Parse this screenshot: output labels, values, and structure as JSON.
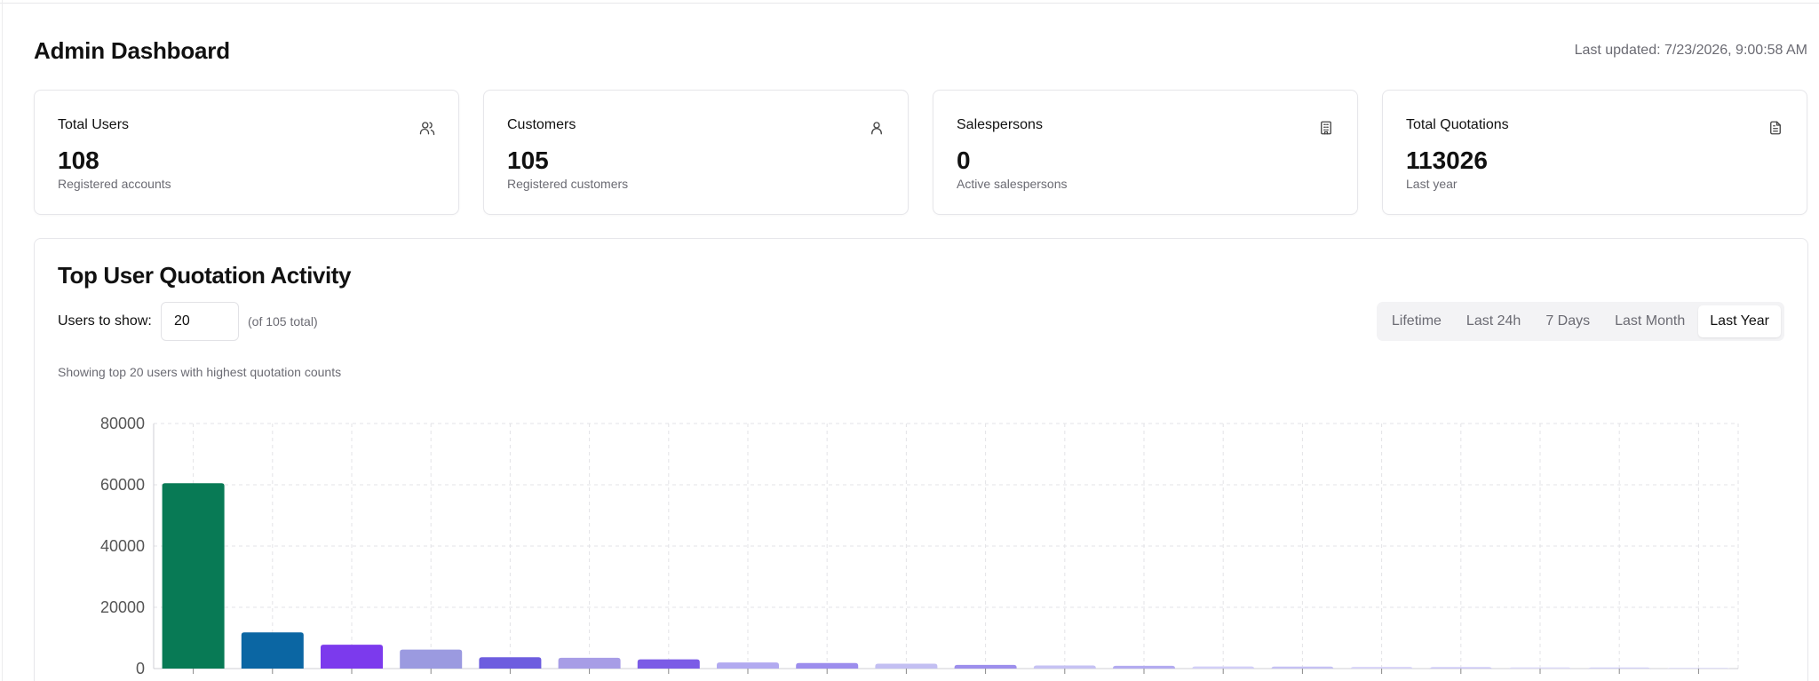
{
  "header": {
    "title": "Admin Dashboard",
    "last_updated": "Last updated: 7/23/2026, 9:00:58 AM"
  },
  "stats": [
    {
      "label": "Total Users",
      "value": "108",
      "sub": "Registered accounts",
      "icon": "users-icon"
    },
    {
      "label": "Customers",
      "value": "105",
      "sub": "Registered customers",
      "icon": "user-icon"
    },
    {
      "label": "Salespersons",
      "value": "0",
      "sub": "Active salespersons",
      "icon": "building-icon"
    },
    {
      "label": "Total Quotations",
      "value": "113026",
      "sub": "Last year",
      "icon": "file-text-icon"
    }
  ],
  "activity": {
    "title": "Top User Quotation Activity",
    "users_label": "Users to show:",
    "users_value": "20",
    "users_total": "(of 105 total)",
    "showing_note": "Showing top 20 users with highest quotation counts",
    "ranges": [
      "Lifetime",
      "Last 24h",
      "7 Days",
      "Last Month",
      "Last Year"
    ],
    "active_range": "Last Year"
  },
  "chart_data": {
    "type": "bar",
    "title": "",
    "xlabel": "",
    "ylabel": "",
    "ylim": [
      0,
      80000
    ],
    "yticks": [
      0,
      20000,
      40000,
      60000,
      80000
    ],
    "grid": true,
    "values": [
      60500,
      11800,
      7800,
      6200,
      3700,
      3500,
      3000,
      2000,
      1800,
      1600,
      1200,
      1000,
      900,
      700,
      650,
      550,
      480,
      400,
      350,
      300
    ],
    "colors": [
      "#087a55",
      "#0b66a3",
      "#7c3aed",
      "#9b9ae0",
      "#6d5ddf",
      "#a79de6",
      "#7b5ce6",
      "#b2aaf0",
      "#9c8ded",
      "#c3bff2",
      "#9d8fec",
      "#c6c2f3",
      "#b3abf0",
      "#d2cff7",
      "#c5c1f3",
      "#d6d3f7",
      "#cbc7f5",
      "#dcdaf8",
      "#d3d0f6",
      "#e1dff9"
    ]
  }
}
